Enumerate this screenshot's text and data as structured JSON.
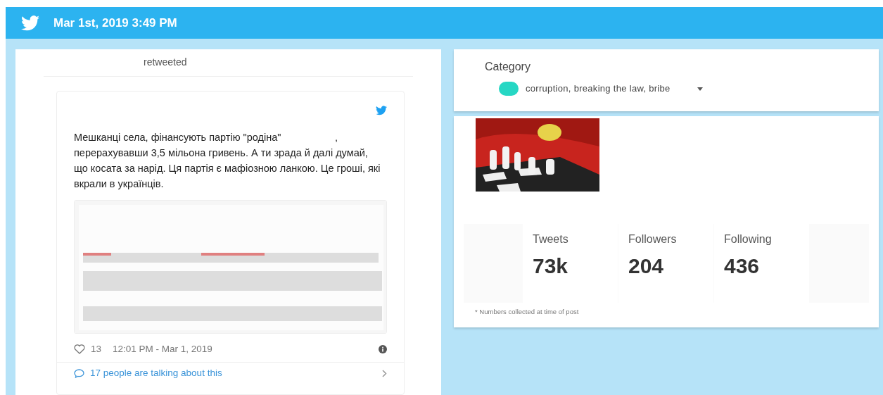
{
  "header": {
    "timestamp": "Mar 1st, 2019 3:49 PM"
  },
  "retweet": {
    "label": "retweeted"
  },
  "tweet": {
    "text": "Мешканці села, фінансують партію \"родіна\"                   , перерахувавши 3,5 мільона гривень. А ти зрада й далі думай, що косата за нарід. Ця партія є мафіозною ланкою. Це гроші, які вкрали в українців.",
    "likes": "13",
    "time": "12:01 PM - Mar 1, 2019",
    "talking": "17 people are talking about this"
  },
  "category": {
    "label": "Category",
    "value": "corruption, breaking the law, bribe",
    "color": "#26d7c4"
  },
  "stats": [
    {
      "label": "Tweets",
      "value": "73k"
    },
    {
      "label": "Followers",
      "value": "204"
    },
    {
      "label": "Following",
      "value": "436"
    }
  ],
  "stats_note": "* Numbers collected at time of post"
}
